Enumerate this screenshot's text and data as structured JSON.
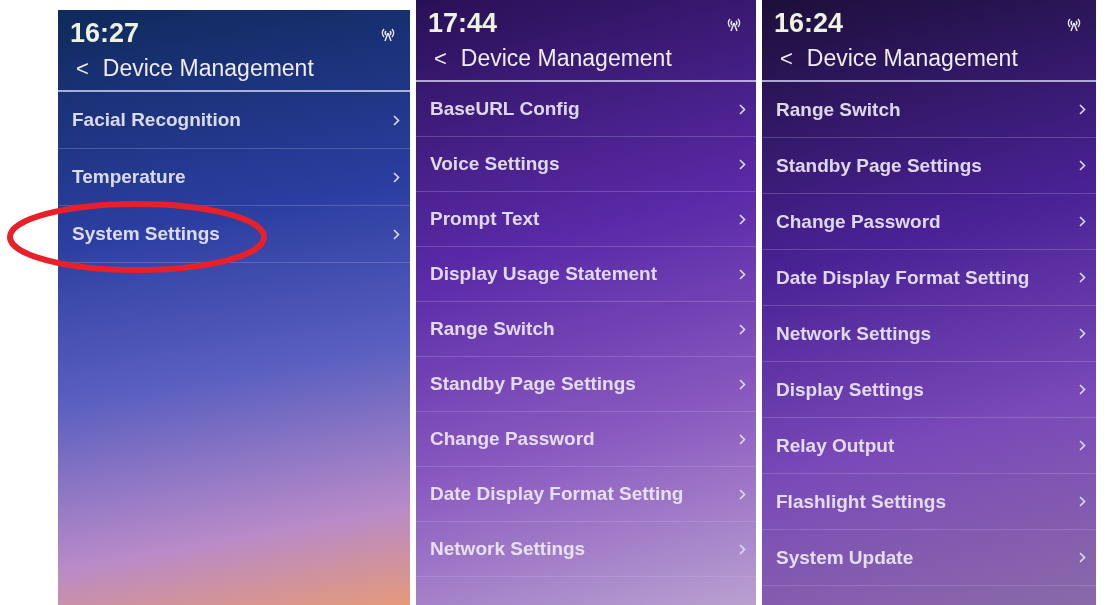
{
  "screens": [
    {
      "time": "16:27",
      "title": "Device Management",
      "back": "<",
      "items": [
        {
          "label": "Facial Recognition",
          "circled": false
        },
        {
          "label": "Temperature",
          "circled": false
        },
        {
          "label": "System Settings",
          "circled": true
        }
      ]
    },
    {
      "time": "17:44",
      "title": "Device Management",
      "back": "<",
      "items": [
        {
          "label": "BaseURL Config",
          "circled": false
        },
        {
          "label": "Voice Settings",
          "circled": false
        },
        {
          "label": "Prompt Text",
          "circled": false
        },
        {
          "label": "Display Usage Statement",
          "circled": false
        },
        {
          "label": "Range Switch",
          "circled": false
        },
        {
          "label": "Standby Page Settings",
          "circled": false
        },
        {
          "label": "Change Password",
          "circled": false
        },
        {
          "label": "Date Display Format Setting",
          "circled": false
        },
        {
          "label": "Network Settings",
          "circled": false
        }
      ]
    },
    {
      "time": "16:24",
      "title": "Device Management",
      "back": "<",
      "items": [
        {
          "label": "Range Switch",
          "circled": false
        },
        {
          "label": "Standby Page Settings",
          "circled": false
        },
        {
          "label": "Change Password",
          "circled": false
        },
        {
          "label": "Date Display Format Setting",
          "circled": false
        },
        {
          "label": "Network Settings",
          "circled": false
        },
        {
          "label": "Display Settings",
          "circled": false
        },
        {
          "label": "Relay Output",
          "circled": false
        },
        {
          "label": "Flashlight Settings",
          "circled": false
        },
        {
          "label": "System Update",
          "circled": false
        }
      ]
    }
  ]
}
